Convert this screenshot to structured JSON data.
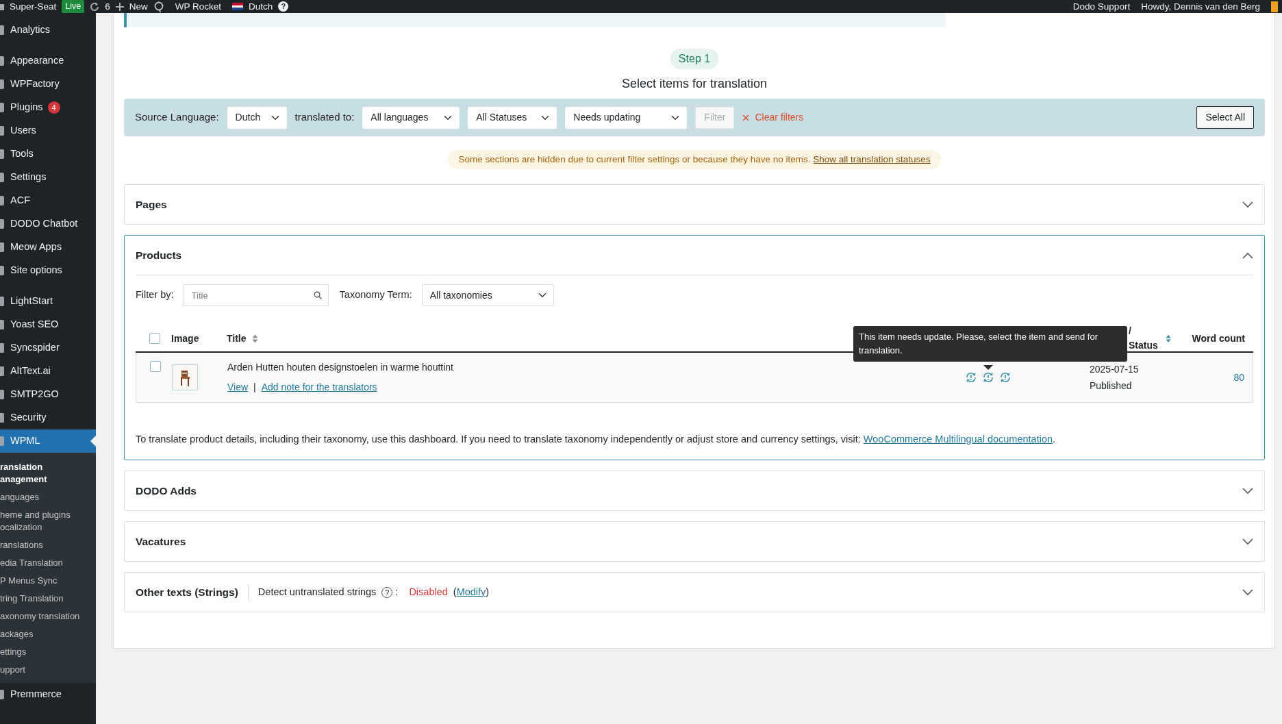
{
  "admin_bar": {
    "site": "Super-Seat",
    "env_badge": "Live",
    "updates": "6",
    "new": "New",
    "plugin": "WP Rocket",
    "language": "Dutch",
    "help": "?",
    "support": "Dodo Support",
    "greeting": "Howdy, Dennis van den Berg"
  },
  "sidebar": {
    "groups": [
      [
        {
          "label": "Analytics",
          "selected": false
        }
      ],
      [
        {
          "label": "Appearance",
          "selected": false
        },
        {
          "label": "WPFactory",
          "selected": false
        },
        {
          "label": "Plugins",
          "selected": false,
          "badge": "4"
        },
        {
          "label": "Users",
          "selected": false
        },
        {
          "label": "Tools",
          "selected": false
        },
        {
          "label": "Settings",
          "selected": false
        },
        {
          "label": "ACF",
          "selected": false
        },
        {
          "label": "DODO Chatbot",
          "selected": false
        },
        {
          "label": "Meow Apps",
          "selected": false
        },
        {
          "label": "Site options",
          "selected": false
        }
      ],
      [
        {
          "label": "LightStart",
          "selected": false
        },
        {
          "label": "Yoast SEO",
          "selected": false
        },
        {
          "label": "Syncspider",
          "selected": false
        },
        {
          "label": "AltText.ai",
          "selected": false
        },
        {
          "label": "SMTP2GO",
          "selected": false
        },
        {
          "label": "Security",
          "selected": false
        },
        {
          "label": "WPML",
          "selected": true
        }
      ]
    ],
    "submenu": [
      {
        "label": "ranslation anagement",
        "selected": true
      },
      {
        "label": "anguages",
        "selected": false
      },
      {
        "label": "heme and plugins ocalization",
        "selected": false
      },
      {
        "label": "ranslations",
        "selected": false
      },
      {
        "label": "edia Translation",
        "selected": false
      },
      {
        "label": "P Menus Sync",
        "selected": false
      },
      {
        "label": "tring Translation",
        "selected": false
      },
      {
        "label": "axonomy translation",
        "selected": false
      },
      {
        "label": "ackages",
        "selected": false
      },
      {
        "label": "ettings",
        "selected": false
      },
      {
        "label": "upport",
        "selected": false
      }
    ],
    "after": [
      {
        "label": "Premmerce",
        "selected": false
      }
    ]
  },
  "step": {
    "badge": "Step 1",
    "title": "Select items for translation"
  },
  "filters": {
    "source_label": "Source Language:",
    "source": "Dutch",
    "target_label": "translated to:",
    "target": "All languages",
    "status": "All Statuses",
    "translation": "Needs updating",
    "filter_button": {
      "label": "Filter",
      "disabled": true
    },
    "clear": "Clear filters",
    "select_all": "Select All"
  },
  "notice": {
    "text": "Some sections are hidden due to current filter settings or because they have no items.",
    "link": "Show all translation statuses"
  },
  "sections": [
    {
      "kind": "plain",
      "title": "Pages",
      "expanded": false
    },
    {
      "kind": "products",
      "title": "Products",
      "expanded": true,
      "filter_label": "Filter by:",
      "search_placeholder": "Title",
      "taxonomy_label": "Taxonomy Term:",
      "taxonomy": "All taxonomies",
      "columns": {
        "image": "Image",
        "title": "Title",
        "status": "/ Status",
        "words": "Word count"
      },
      "select_all_checked": false,
      "rows": [
        {
          "checked": false,
          "title": "Arden Hutten houten designstoelen in warme houttint",
          "view": "View",
          "separator": "|",
          "note": "Add note for the translators",
          "translations": [
            {
              "kind": "needs_update"
            },
            {
              "kind": "needs_update"
            },
            {
              "kind": "needs_update"
            }
          ],
          "date": "2025-07-15",
          "status": "Published",
          "words": "80"
        }
      ],
      "tooltip": "This item needs update. Please, select the item and send for translation.",
      "footer": "To translate product details, including their taxonomy, use this dashboard. If you need to translate taxonomy independently or adjust store and currency settings, visit:",
      "footer_link": "WooCommerce Multilingual documentation",
      "footer_end": "."
    },
    {
      "kind": "plain",
      "title": "DODO Adds",
      "expanded": false
    },
    {
      "kind": "plain",
      "title": "Vacatures",
      "expanded": false
    },
    {
      "kind": "strings",
      "title": "Other texts (Strings)",
      "expanded": false,
      "detect_label": "Detect untranslated strings",
      "help": "?",
      "colon": ":",
      "detect_value": "Disabled",
      "paren_open": "(",
      "modify": "Modify",
      "paren_close": ")"
    }
  ]
}
